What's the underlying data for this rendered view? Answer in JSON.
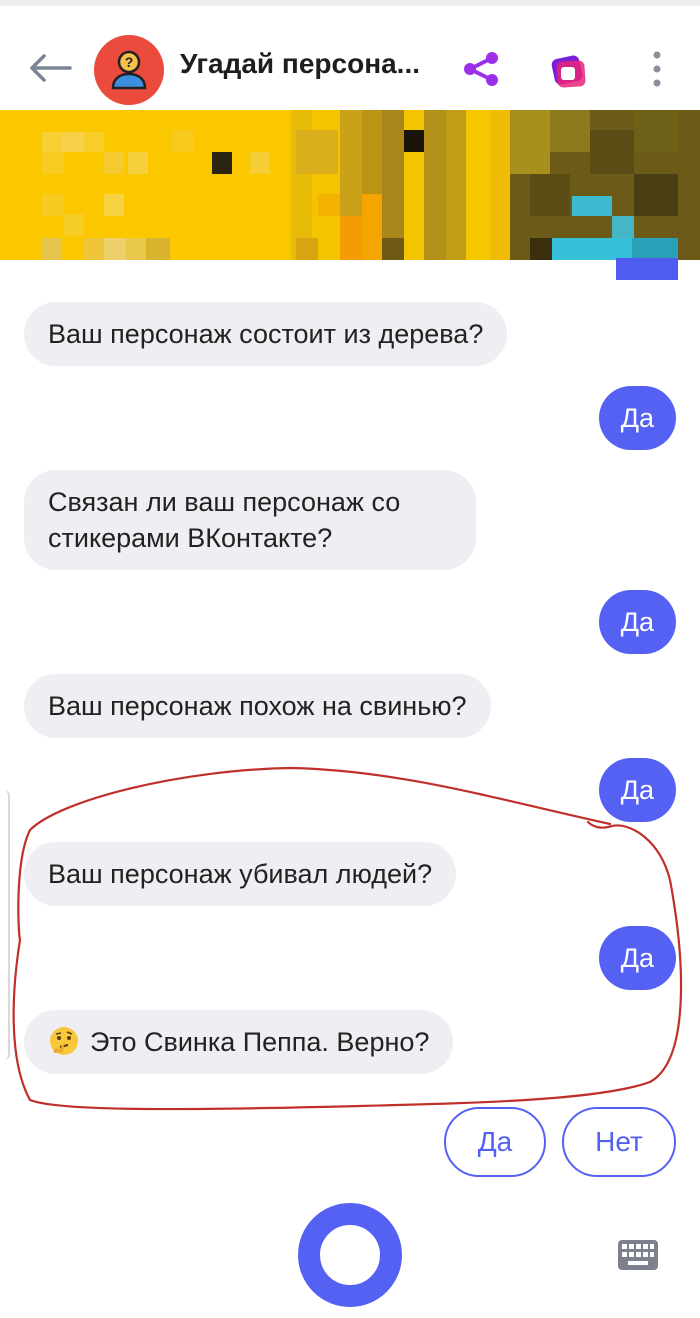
{
  "header": {
    "title": "Угадай персона...",
    "back_icon": "arrow-left-icon",
    "avatar_icon": "question-person-icon",
    "share_icon": "share-icon",
    "skills_icon": "skills-icon",
    "menu_icon": "more-vertical-icon"
  },
  "banner": {
    "description_icon": "pixelated-image"
  },
  "messages": [
    {
      "from": "bot",
      "text": "Ваш персонаж состоит из дерева?"
    },
    {
      "from": "user",
      "text": "Да"
    },
    {
      "from": "bot",
      "text": "Связан ли ваш персонаж со стикерами ВКонтакте?"
    },
    {
      "from": "user",
      "text": "Да"
    },
    {
      "from": "bot",
      "text": "Ваш персонаж похож на свинью?"
    },
    {
      "from": "user",
      "text": "Да"
    },
    {
      "from": "bot",
      "text": "Ваш персонаж убивал людей?"
    },
    {
      "from": "user",
      "text": "Да"
    },
    {
      "from": "bot",
      "emoji": "🤔",
      "text": "Это Свинка Пеппа. Верно?"
    }
  ],
  "suggestions": [
    "Да",
    "Нет"
  ],
  "input": {
    "mic_icon": "voice-ring-icon",
    "keyboard_icon": "keyboard-icon"
  },
  "colors": {
    "accent": "#5561f2",
    "bot_bubble": "#efeff3",
    "avatar": "#ea4b3c",
    "share": "#9b30e8",
    "annotation": "#c0302a"
  }
}
